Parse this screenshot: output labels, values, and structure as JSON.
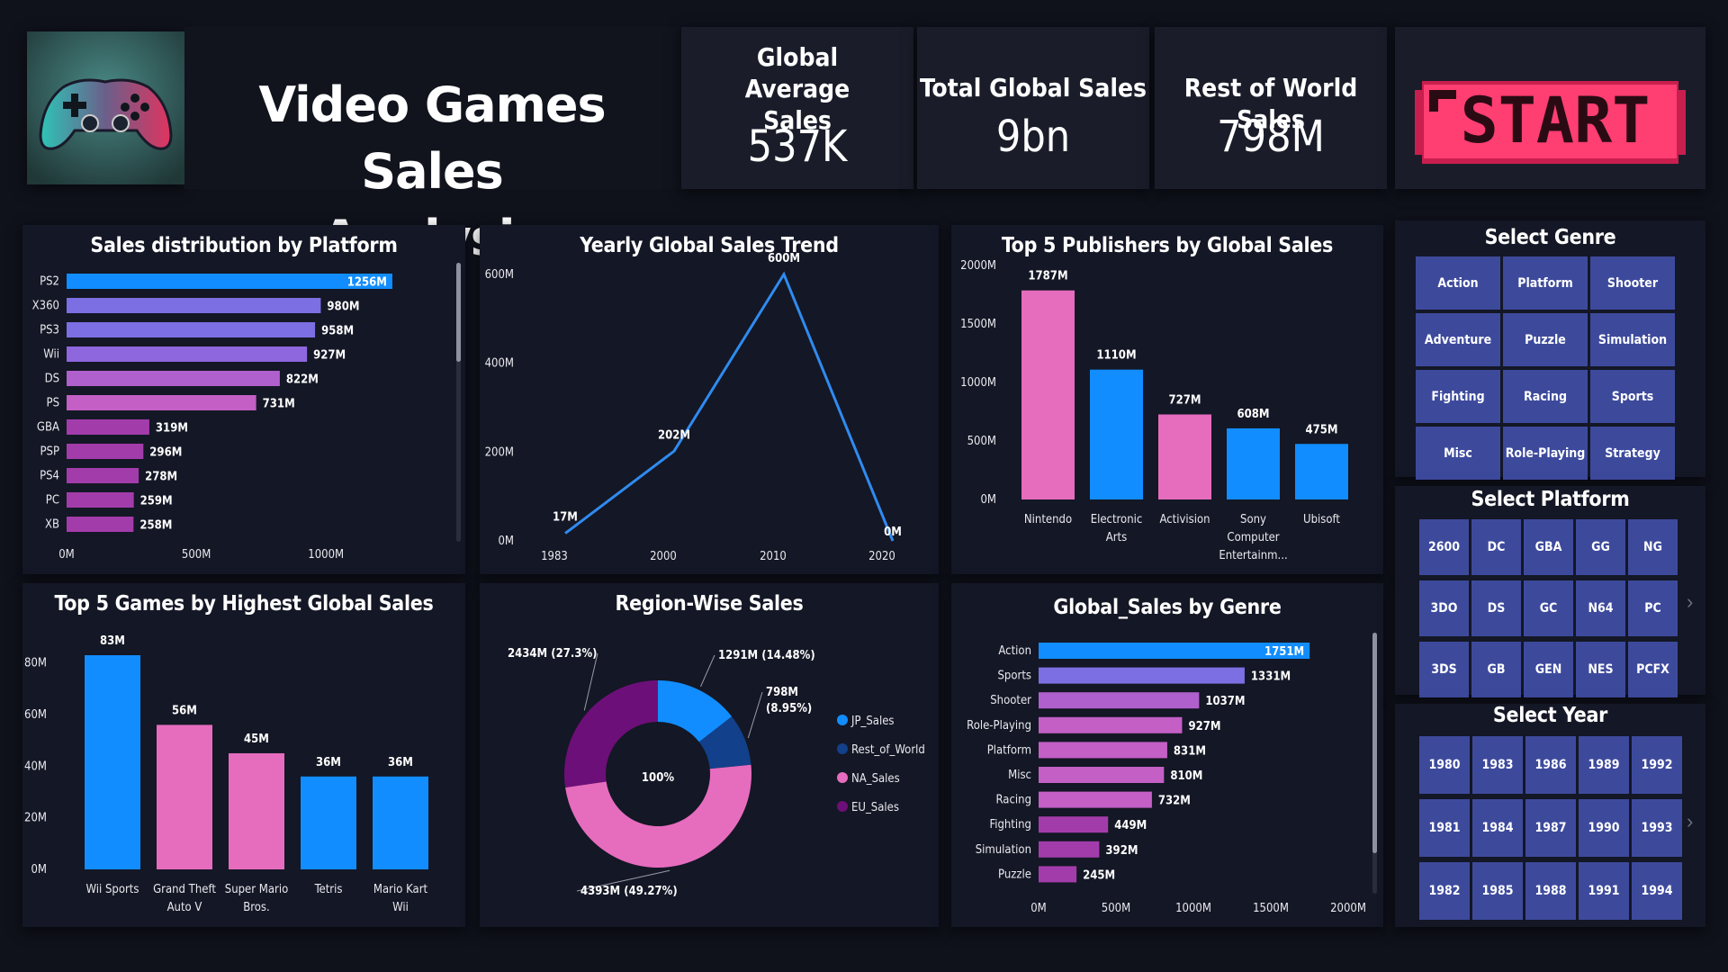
{
  "header": {
    "title": "Video Games Sales Analysis",
    "logo_icon": "gamepad-icon",
    "start_label": "START"
  },
  "kpis": [
    {
      "label": "Global Average Sales",
      "value": "537K"
    },
    {
      "label": "Total Global Sales",
      "value": "9bn"
    },
    {
      "label": "Rest of World Sales",
      "value": "798M"
    }
  ],
  "colors": {
    "blue": "#118dff",
    "pink": "#e66cbe",
    "purple": "#8a2d9e",
    "indigo": "#7b6fe3",
    "navy": "#12408a",
    "dark_purple": "#6d0f78",
    "button": "#3d4a9c"
  },
  "slicers": {
    "genre": {
      "title": "Select Genre",
      "options": [
        "Action",
        "Platform",
        "Shooter",
        "Adventure",
        "Puzzle",
        "Simulation",
        "Fighting",
        "Racing",
        "Sports",
        "Misc",
        "Role-Playing",
        "Strategy"
      ]
    },
    "platform": {
      "title": "Select Platform",
      "options": [
        "2600",
        "DC",
        "GBA",
        "GG",
        "NG",
        "3DO",
        "DS",
        "GC",
        "N64",
        "PC",
        "3DS",
        "GB",
        "GEN",
        "NES",
        "PCFX"
      ]
    },
    "year": {
      "title": "Select Year",
      "options": [
        "1980",
        "1983",
        "1986",
        "1989",
        "1992",
        "1981",
        "1984",
        "1987",
        "1990",
        "1993",
        "1982",
        "1985",
        "1988",
        "1991",
        "1994"
      ]
    }
  },
  "chart_data": [
    {
      "id": "platform",
      "type": "bar",
      "orientation": "horizontal",
      "title": "Sales distribution by Platform",
      "categories": [
        "PS2",
        "X360",
        "PS3",
        "Wii",
        "DS",
        "PS",
        "GBA",
        "PSP",
        "PS4",
        "PC",
        "XB"
      ],
      "values": [
        1256,
        980,
        958,
        927,
        822,
        731,
        319,
        296,
        278,
        259,
        258
      ],
      "labels": [
        "1256M",
        "980M",
        "958M",
        "927M",
        "822M",
        "731M",
        "319M",
        "296M",
        "278M",
        "259M",
        "258M"
      ],
      "colors": [
        "#118dff",
        "#7b6fe3",
        "#7b6fe3",
        "#8e66de",
        "#b060cc",
        "#c35fc5",
        "#a33cab",
        "#a33cab",
        "#a33cab",
        "#a33cab",
        "#a33cab"
      ],
      "xticks": [
        "0M",
        "500M",
        "1000M"
      ],
      "xtick_values": [
        0,
        500,
        1000
      ],
      "xlim": [
        0,
        1270
      ]
    },
    {
      "id": "trend",
      "type": "line",
      "title": "Yearly Global Sales Trend",
      "x": [
        "1983",
        "2000",
        "2010",
        "2020"
      ],
      "values": [
        17,
        202,
        600,
        0
      ],
      "labels": [
        "17M",
        "202M",
        "600M",
        "0M"
      ],
      "yticks": [
        "0M",
        "200M",
        "400M",
        "600M"
      ],
      "ytick_values": [
        0,
        200,
        400,
        600
      ],
      "ylim": [
        0,
        640
      ]
    },
    {
      "id": "publishers",
      "type": "bar",
      "title": "Top 5 Publishers by Global Sales",
      "categories": [
        "Nintendo",
        "Electronic Arts",
        "Activision",
        "Sony Computer Entertainm...",
        "Ubisoft"
      ],
      "category_lines": [
        [
          "Nintendo"
        ],
        [
          "Electronic",
          "Arts"
        ],
        [
          "Activision"
        ],
        [
          "Sony",
          "Computer",
          "Entertainm..."
        ],
        [
          "Ubisoft"
        ]
      ],
      "values": [
        1787,
        1110,
        727,
        608,
        475
      ],
      "labels": [
        "1787M",
        "1110M",
        "727M",
        "608M",
        "475M"
      ],
      "colors": [
        "#e66cbe",
        "#118dff",
        "#e66cbe",
        "#118dff",
        "#118dff"
      ],
      "yticks": [
        "0M",
        "500M",
        "1000M",
        "1500M",
        "2000M"
      ],
      "ytick_values": [
        0,
        500,
        1000,
        1500,
        2000
      ],
      "ylim": [
        0,
        2000
      ]
    },
    {
      "id": "games",
      "type": "bar",
      "title": "Top 5 Games by Highest Global Sales",
      "categories": [
        "Wii Sports",
        "Grand Theft Auto V",
        "Super Mario Bros.",
        "Tetris",
        "Mario Kart Wii"
      ],
      "category_lines": [
        [
          "Wii Sports"
        ],
        [
          "Grand Theft",
          "Auto V"
        ],
        [
          "Super Mario",
          "Bros."
        ],
        [
          "Tetris"
        ],
        [
          "Mario Kart",
          "Wii"
        ]
      ],
      "values": [
        83,
        56,
        45,
        36,
        36
      ],
      "labels": [
        "83M",
        "56M",
        "45M",
        "36M",
        "36M"
      ],
      "colors": [
        "#118dff",
        "#e66cbe",
        "#e66cbe",
        "#118dff",
        "#118dff"
      ],
      "yticks": [
        "0M",
        "20M",
        "40M",
        "60M",
        "80M"
      ],
      "ytick_values": [
        0,
        20,
        40,
        60,
        80
      ],
      "ylim": [
        0,
        83
      ]
    },
    {
      "id": "region",
      "type": "pie",
      "subtype": "donut",
      "title": "Region-Wise Sales",
      "center_label": "100%",
      "slices": [
        {
          "name": "JP_Sales",
          "value": 1291,
          "percent": 14.48,
          "label": "1291M (14.48%)",
          "color": "#118dff"
        },
        {
          "name": "Rest_of_World",
          "value": 798,
          "percent": 8.95,
          "label": "798M (8.95%)",
          "color": "#12408a"
        },
        {
          "name": "NA_Sales",
          "value": 4393,
          "percent": 49.27,
          "label": "4393M (49.27%)",
          "color": "#e66cbe"
        },
        {
          "name": "EU_Sales",
          "value": 2434,
          "percent": 27.3,
          "label": "2434M (27.3%)",
          "color": "#6d0f78"
        }
      ],
      "legend": [
        "JP_Sales",
        "Rest_of_World",
        "NA_Sales",
        "EU_Sales"
      ],
      "legend_position": "right"
    },
    {
      "id": "genre",
      "type": "bar",
      "orientation": "horizontal",
      "title": "Global_Sales by Genre",
      "categories": [
        "Action",
        "Sports",
        "Shooter",
        "Role-Playing",
        "Platform",
        "Misc",
        "Racing",
        "Fighting",
        "Simulation",
        "Puzzle"
      ],
      "values": [
        1751,
        1331,
        1037,
        927,
        831,
        810,
        732,
        449,
        392,
        245
      ],
      "labels": [
        "1751M",
        "1331M",
        "1037M",
        "927M",
        "831M",
        "810M",
        "732M",
        "449M",
        "392M",
        "245M"
      ],
      "colors": [
        "#118dff",
        "#7b6fe3",
        "#b060cc",
        "#c35fc5",
        "#c35fc5",
        "#c35fc5",
        "#c35fc5",
        "#a33cab",
        "#a33cab",
        "#a33cab"
      ],
      "xticks": [
        "0M",
        "500M",
        "1000M",
        "1500M",
        "2000M"
      ],
      "xtick_values": [
        0,
        500,
        1000,
        1500,
        2000
      ],
      "xlim": [
        0,
        2000
      ]
    }
  ]
}
